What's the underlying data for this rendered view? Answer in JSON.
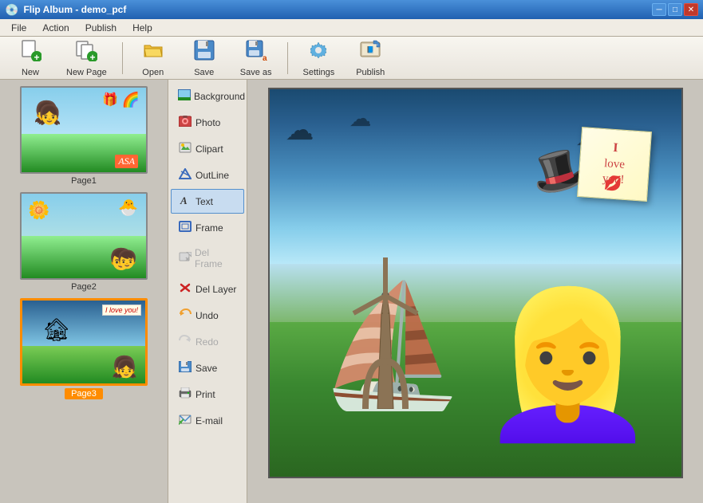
{
  "window": {
    "title": "Flip Album - demo_pcf",
    "icon": "💿"
  },
  "title_bar": {
    "minimize_label": "─",
    "maximize_label": "□",
    "close_label": "✕"
  },
  "menu": {
    "items": [
      "File",
      "Action",
      "Publish",
      "Help"
    ]
  },
  "toolbar": {
    "new_label": "New",
    "new_page_label": "New Page",
    "open_label": "Open",
    "save_label": "Save",
    "save_as_label": "Save as",
    "settings_label": "Settings",
    "publish_label": "Publish"
  },
  "pages": [
    {
      "id": "page1",
      "label": "Page1",
      "active": false
    },
    {
      "id": "page2",
      "label": "Page2",
      "active": false
    },
    {
      "id": "page3",
      "label": "Page3",
      "active": true
    }
  ],
  "tools": [
    {
      "id": "background",
      "label": "Background",
      "icon": "🖼",
      "active": false,
      "disabled": false
    },
    {
      "id": "photo",
      "label": "Photo",
      "icon": "📷",
      "active": false,
      "disabled": false
    },
    {
      "id": "clipart",
      "label": "Clipart",
      "icon": "✂",
      "active": false,
      "disabled": false
    },
    {
      "id": "outline",
      "label": "OutLine",
      "icon": "⬡",
      "active": false,
      "disabled": false
    },
    {
      "id": "text",
      "label": "Text",
      "icon": "A",
      "active": true,
      "disabled": false
    },
    {
      "id": "frame",
      "label": "Frame",
      "icon": "⬜",
      "active": false,
      "disabled": false
    },
    {
      "id": "del-frame",
      "label": "Del Frame",
      "icon": "💬",
      "active": false,
      "disabled": true
    },
    {
      "id": "del-layer",
      "label": "Del Layer",
      "icon": "✖",
      "active": false,
      "disabled": false
    },
    {
      "id": "undo",
      "label": "Undo",
      "icon": "↩",
      "active": false,
      "disabled": false
    },
    {
      "id": "redo",
      "label": "Redo",
      "icon": "↪",
      "active": false,
      "disabled": true
    },
    {
      "id": "save",
      "label": "Save",
      "icon": "💾",
      "active": false,
      "disabled": false
    },
    {
      "id": "print",
      "label": "Print",
      "icon": "🖨",
      "active": false,
      "disabled": false
    },
    {
      "id": "email",
      "label": "E-mail",
      "icon": "📧",
      "active": false,
      "disabled": false
    }
  ],
  "canvas": {
    "note_line1": "I",
    "note_line2": "love",
    "note_line3": "you!"
  }
}
